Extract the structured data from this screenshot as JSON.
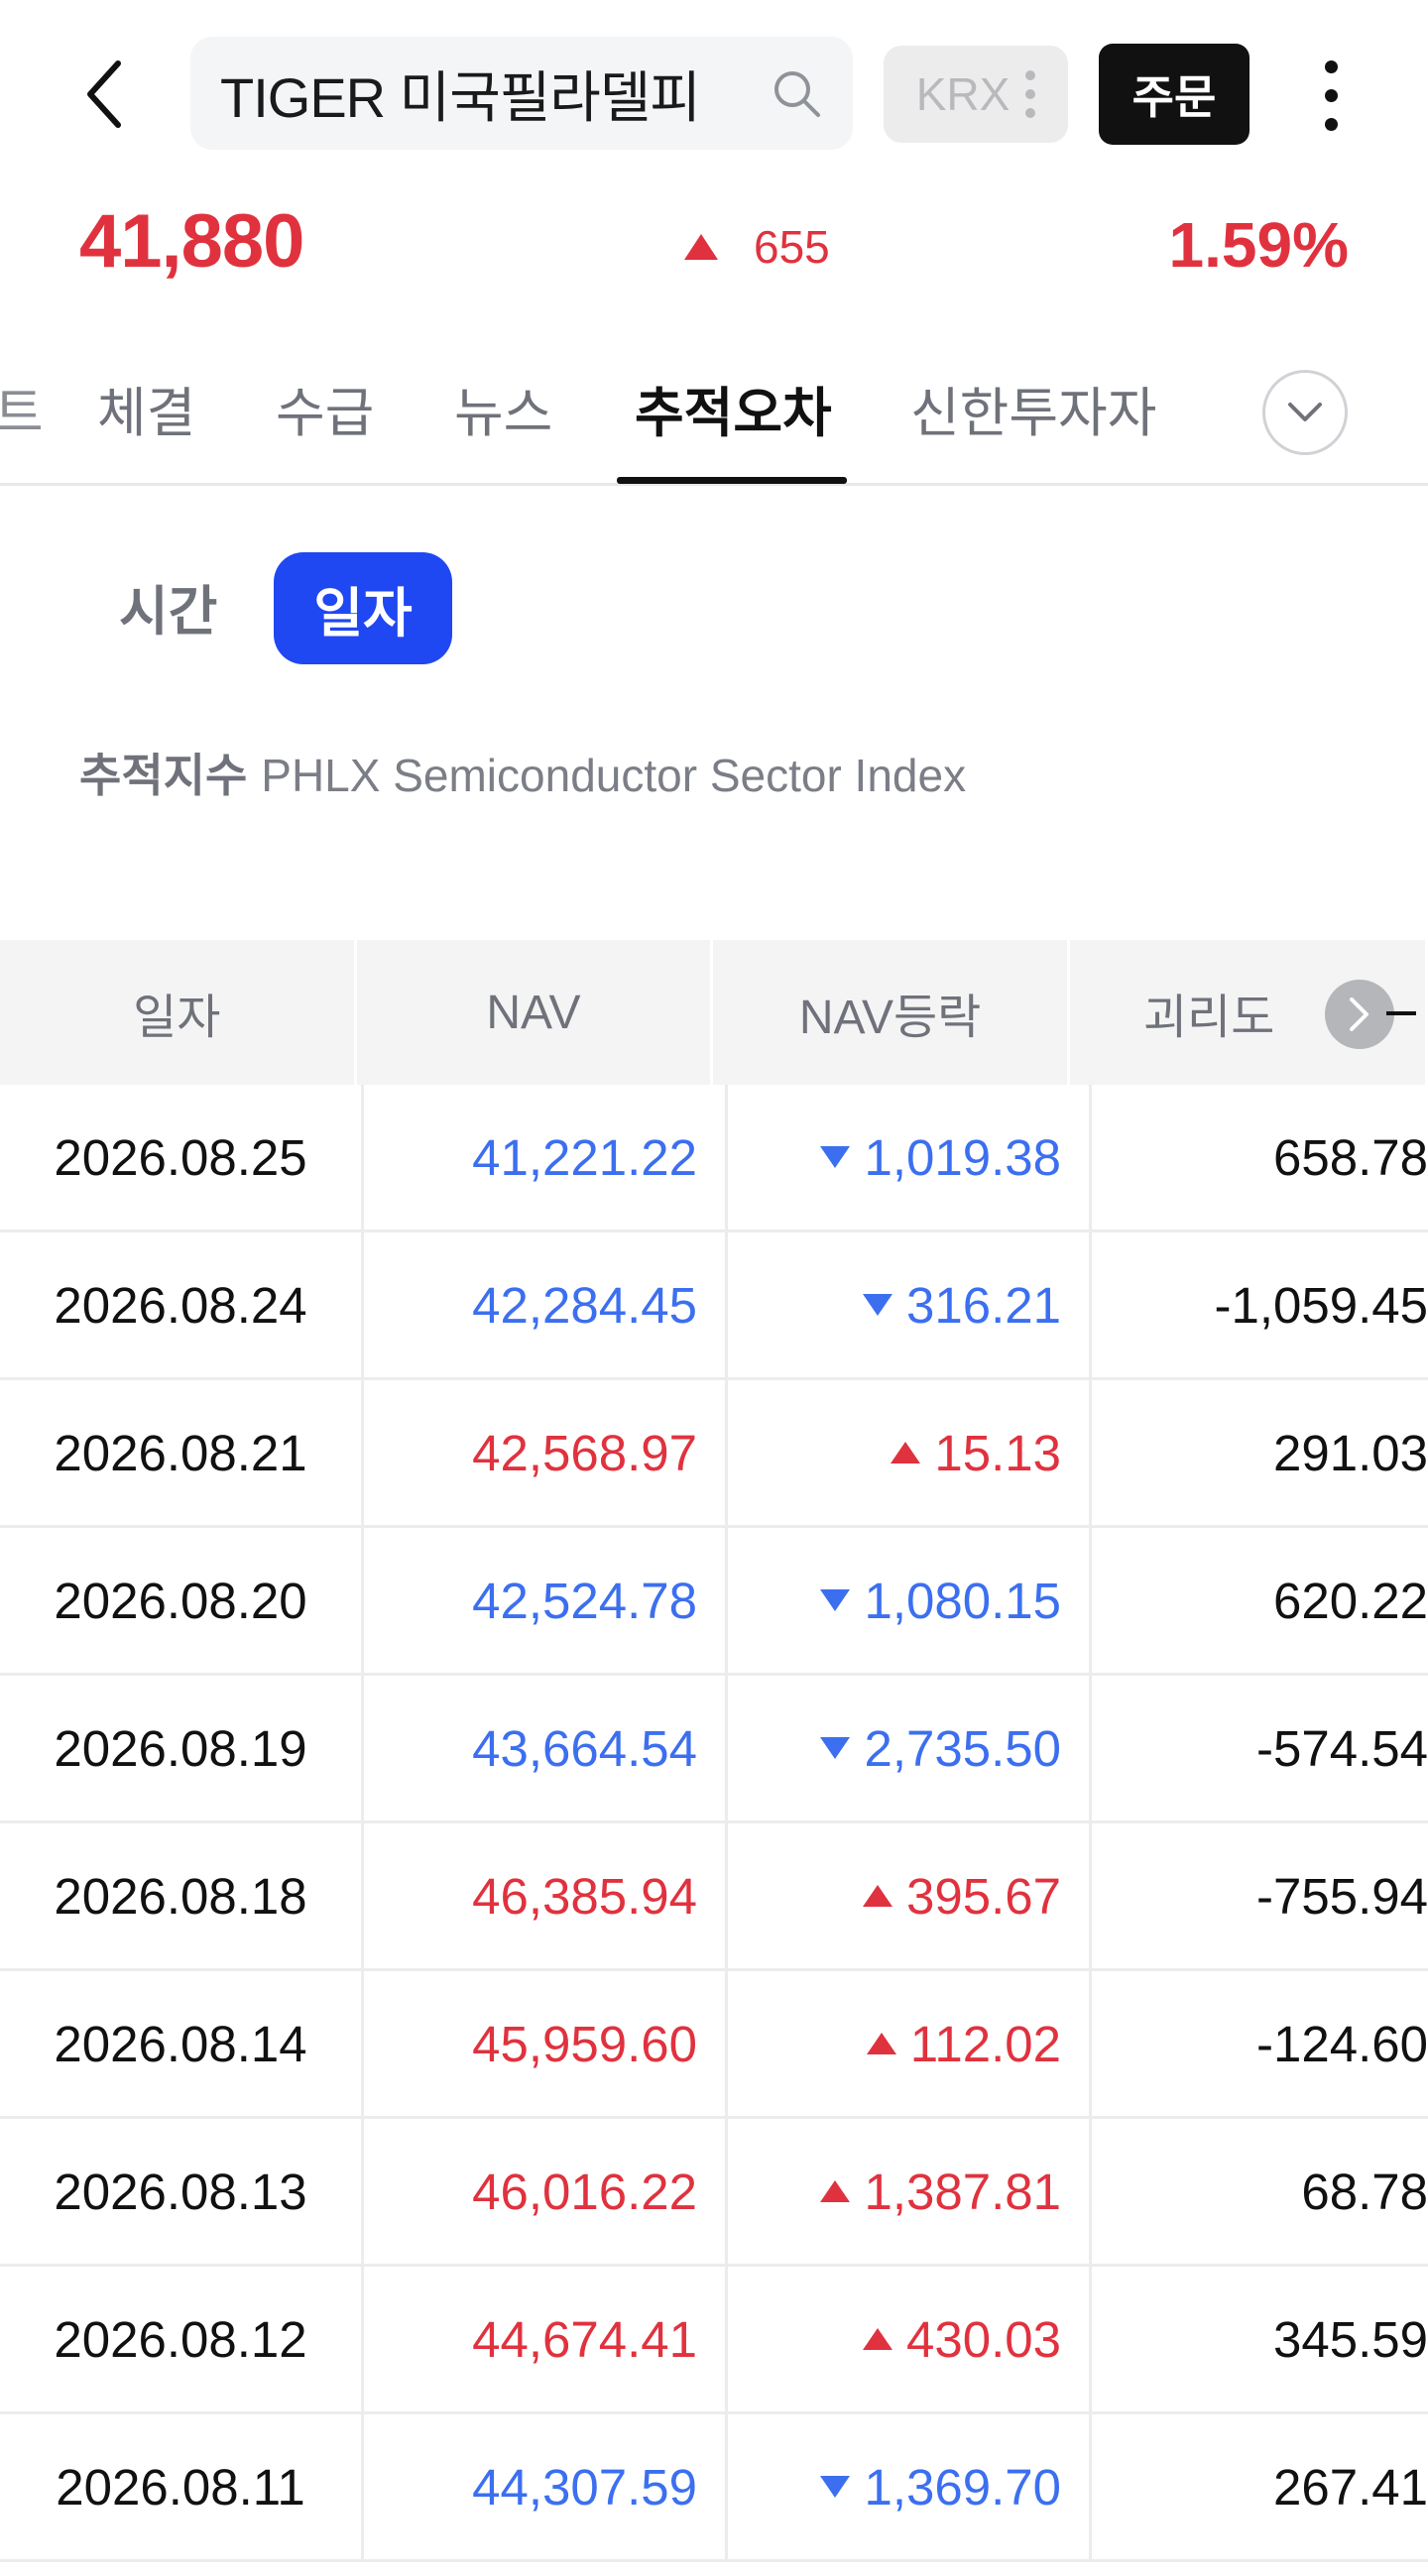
{
  "header": {
    "search_text": "TIGER 미국필라델피",
    "exchange": "KRX",
    "order_label": "주문"
  },
  "quote": {
    "price": "41,880",
    "change": "655",
    "change_direction": "up",
    "change_rate": "1.59%"
  },
  "tabs": {
    "partial": "트",
    "items": [
      "체결",
      "수급",
      "뉴스",
      "추적오차",
      "신한투자자"
    ],
    "active": "추적오차"
  },
  "segment": {
    "time_label": "시간",
    "day_label": "일자",
    "active": "일자"
  },
  "tracking": {
    "label": "추적지수",
    "value": "PHLX Semiconductor Sector Index"
  },
  "table": {
    "headers": [
      "일자",
      "NAV",
      "NAV등락",
      "괴리도"
    ],
    "rows": [
      {
        "date": "2026.08.25",
        "nav": "41,221.22",
        "nav_change": "1,019.38",
        "dir": "down",
        "gap": "658.78"
      },
      {
        "date": "2026.08.24",
        "nav": "42,284.45",
        "nav_change": "316.21",
        "dir": "down",
        "gap": "-1,059.45"
      },
      {
        "date": "2026.08.21",
        "nav": "42,568.97",
        "nav_change": "15.13",
        "dir": "up",
        "gap": "291.03"
      },
      {
        "date": "2026.08.20",
        "nav": "42,524.78",
        "nav_change": "1,080.15",
        "dir": "down",
        "gap": "620.22"
      },
      {
        "date": "2026.08.19",
        "nav": "43,664.54",
        "nav_change": "2,735.50",
        "dir": "down",
        "gap": "-574.54"
      },
      {
        "date": "2026.08.18",
        "nav": "46,385.94",
        "nav_change": "395.67",
        "dir": "up",
        "gap": "-755.94"
      },
      {
        "date": "2026.08.14",
        "nav": "45,959.60",
        "nav_change": "112.02",
        "dir": "up",
        "gap": "-124.60"
      },
      {
        "date": "2026.08.13",
        "nav": "46,016.22",
        "nav_change": "1,387.81",
        "dir": "up",
        "gap": "68.78"
      },
      {
        "date": "2026.08.12",
        "nav": "44,674.41",
        "nav_change": "430.03",
        "dir": "up",
        "gap": "345.59"
      },
      {
        "date": "2026.08.11",
        "nav": "44,307.59",
        "nav_change": "1,369.70",
        "dir": "down",
        "gap": "267.41"
      }
    ]
  },
  "colors": {
    "up": "#e0323e",
    "down": "#3c6ff0",
    "accent": "#1f47f2"
  },
  "icons": {
    "back": "chevron-left-icon",
    "search": "search-icon",
    "more": "more-vertical-icon",
    "expand": "chevron-down-icon",
    "scroll": "chevron-right-icon"
  }
}
